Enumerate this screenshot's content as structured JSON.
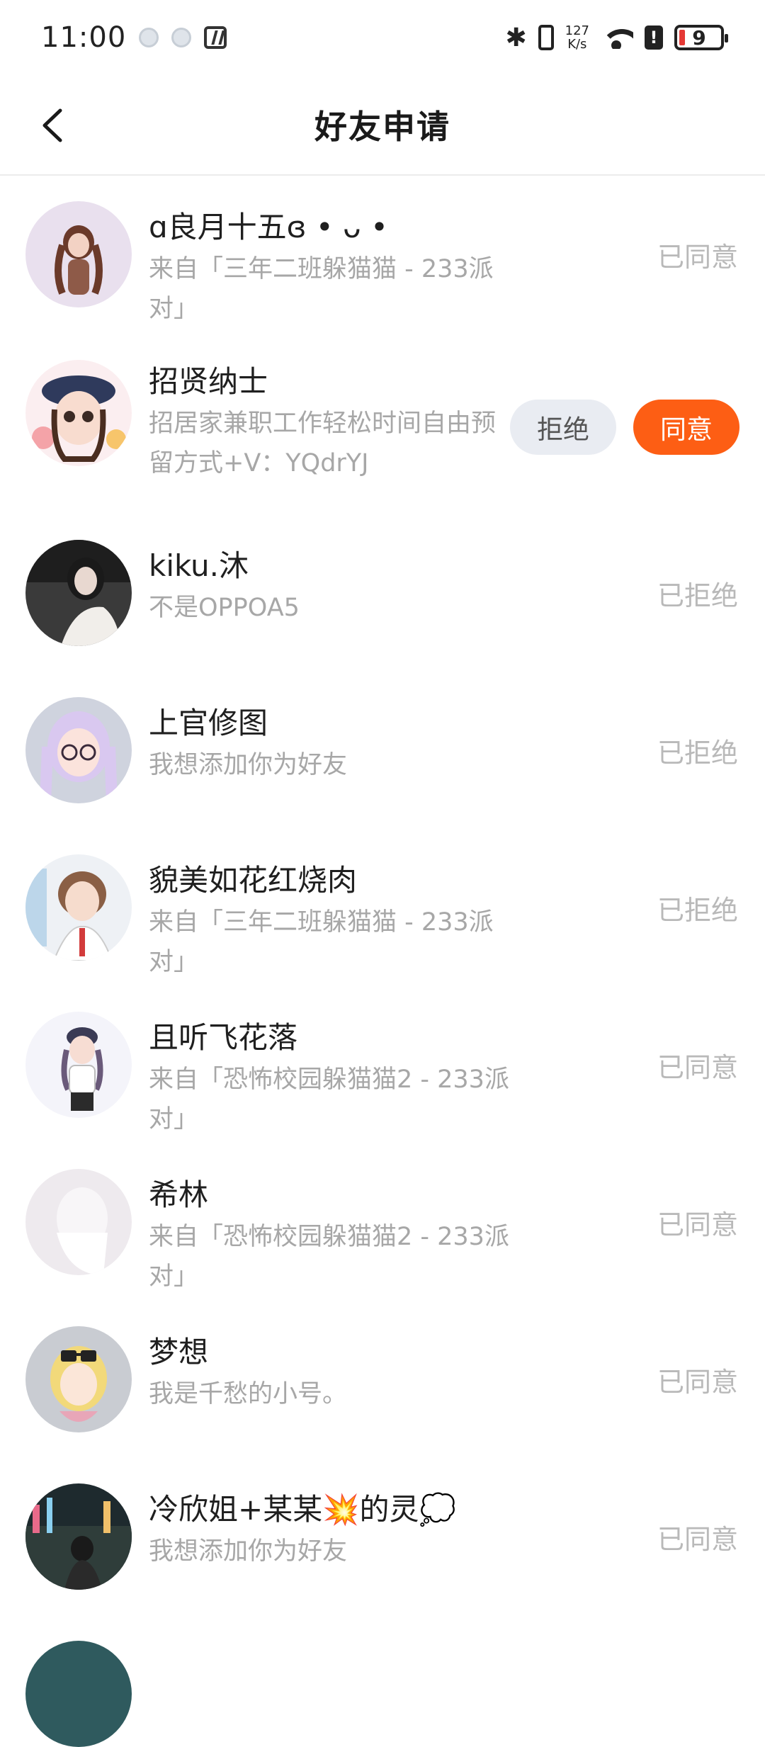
{
  "status_bar": {
    "time": "11:00",
    "speed_value": "127",
    "speed_unit": "K/s",
    "battery": "9"
  },
  "header": {
    "title": "好友申请"
  },
  "requests": [
    {
      "name": "ɑ良月十五ɞ • ᴗ •",
      "message": "来自「三年二班躲猫猫 - 233派对」",
      "status": "已同意"
    },
    {
      "name": "招贤纳士",
      "message": "招居家兼职工作轻松时间自由预留方式+V：YQdrYJ",
      "reject_label": "拒绝",
      "accept_label": "同意"
    },
    {
      "name": "kiku.沐",
      "message": "不是OPPOA5",
      "status": "已拒绝"
    },
    {
      "name": "上官修图",
      "message": "我想添加你为好友",
      "status": "已拒绝"
    },
    {
      "name": "貌美如花红烧肉",
      "message": "来自「三年二班躲猫猫 - 233派对」",
      "status": "已拒绝"
    },
    {
      "name": "且听飞花落",
      "message": "来自「恐怖校园躲猫猫2 - 233派对」",
      "status": "已同意"
    },
    {
      "name": "希林",
      "message": "来自「恐怖校园躲猫猫2 - 233派对」",
      "status": "已同意"
    },
    {
      "name": "梦想",
      "message": "我是千愁的小号。",
      "status": "已同意"
    },
    {
      "name": "冷欣姐+某某💥的灵💭",
      "message": "我想添加你为好友",
      "status": "已同意"
    }
  ]
}
